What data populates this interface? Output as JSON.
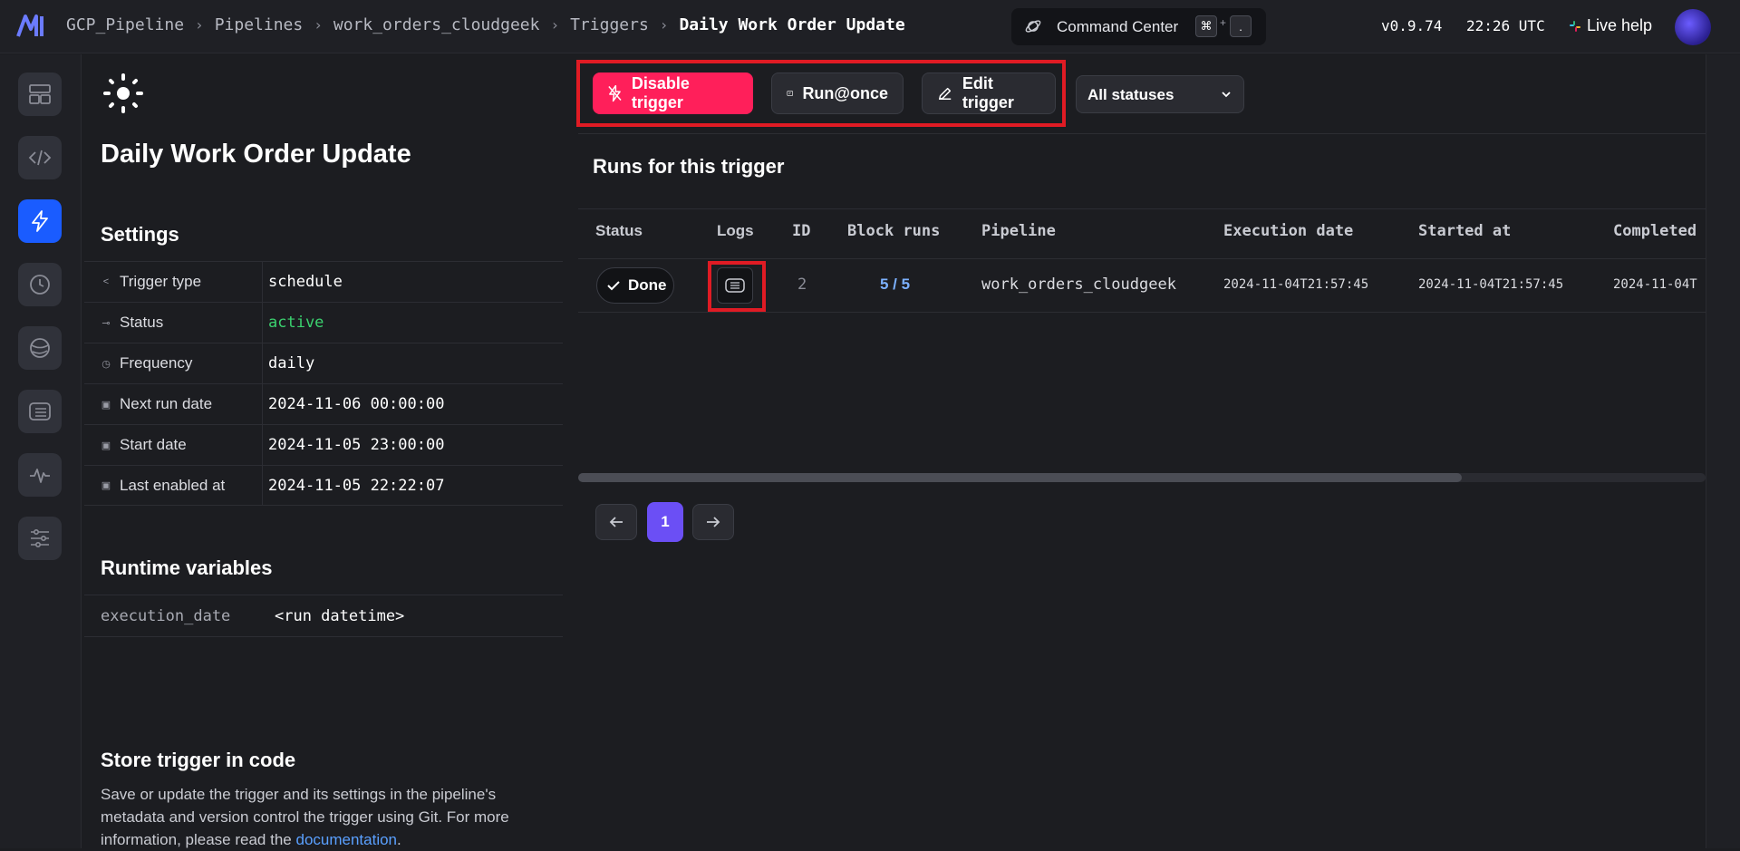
{
  "header": {
    "breadcrumbs": [
      "GCP_Pipeline",
      "Pipelines",
      "work_orders_cloudgeek",
      "Triggers",
      "Daily Work Order Update"
    ],
    "command_center": {
      "label": "Command Center",
      "key1": "⌘",
      "key2": "."
    },
    "version": "v0.9.74",
    "time": "22:26 UTC",
    "live_help": "Live help"
  },
  "nav": {
    "items": [
      "dashboard",
      "code",
      "triggers",
      "schedule",
      "global",
      "files",
      "monitor",
      "settings"
    ]
  },
  "trigger": {
    "title": "Daily Work Order Update",
    "settings_heading": "Settings",
    "settings": [
      {
        "label": "Trigger type",
        "value": "schedule",
        "icon": "share-icon"
      },
      {
        "label": "Status",
        "value": "active",
        "icon": "toggle-icon"
      },
      {
        "label": "Frequency",
        "value": "daily",
        "icon": "clock-icon"
      },
      {
        "label": "Next run date",
        "value": "2024-11-06 00:00:00",
        "icon": "calendar-icon"
      },
      {
        "label": "Start date",
        "value": "2024-11-05 23:00:00",
        "icon": "calendar-icon"
      },
      {
        "label": "Last enabled at",
        "value": "2024-11-05 22:22:07",
        "icon": "calendar-icon"
      }
    ],
    "runtime_heading": "Runtime variables",
    "runtime_variables": [
      {
        "key": "execution_date",
        "value": "<run datetime>"
      }
    ],
    "store_heading": "Store trigger in code",
    "store_text": "Save or update the trigger and its settings in the pipeline's metadata and version control the trigger using Git. For more information, please read the",
    "store_link": "documentation",
    "store_end": "."
  },
  "toolbar": {
    "disable": "Disable trigger",
    "run_once": "Run@once",
    "edit": "Edit trigger",
    "status_filter": "All statuses"
  },
  "runs": {
    "heading": "Runs for this trigger",
    "columns": [
      "Status",
      "Logs",
      "ID",
      "Block runs",
      "Pipeline",
      "Execution date",
      "Started at",
      "Completed"
    ],
    "rows": [
      {
        "status": "Done",
        "id": "2",
        "block_runs": "5 / 5",
        "pipeline": "work_orders_cloudgeek",
        "execution_date": "2024-11-04T21:57:45",
        "started_at": "2024-11-04T21:57:45",
        "completed": "2024-11-04T"
      }
    ],
    "current_page": "1"
  },
  "colors": {
    "accent_blue": "#1a5cff",
    "danger": "#ff1f5a",
    "active_green": "#3bd16f",
    "page_purple": "#6b4ff5",
    "highlight_red": "#e01b24"
  }
}
